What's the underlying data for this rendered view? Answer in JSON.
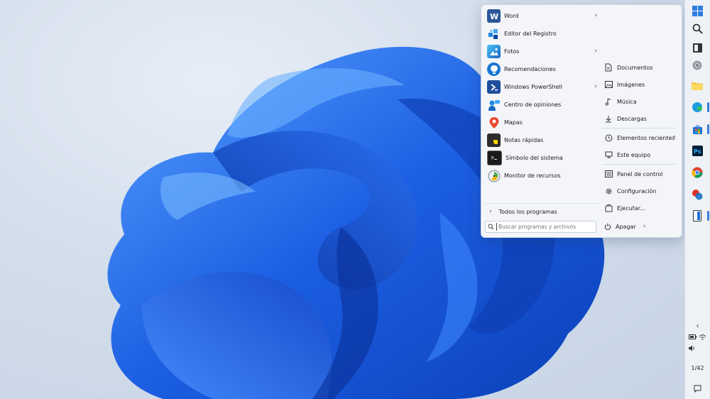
{
  "start_menu": {
    "programs": [
      {
        "label": "Word",
        "icon": "word-icon",
        "has_submenu": true
      },
      {
        "label": "Editor del Registro",
        "icon": "registry-editor-icon",
        "has_submenu": false
      },
      {
        "label": "Fotos",
        "icon": "photos-icon",
        "has_submenu": true
      },
      {
        "label": "Recomendaciones",
        "icon": "tips-icon",
        "has_submenu": false
      },
      {
        "label": "Windows PowerShell",
        "icon": "powershell-icon",
        "has_submenu": true
      },
      {
        "label": "Centro de opiniones",
        "icon": "feedback-hub-icon",
        "has_submenu": false
      },
      {
        "label": "Mapas",
        "icon": "maps-icon",
        "has_submenu": false
      },
      {
        "label": "Notas rápidas",
        "icon": "sticky-notes-icon",
        "has_submenu": false
      },
      {
        "label": "Símbolo del sistema",
        "icon": "command-prompt-icon",
        "has_submenu": false
      },
      {
        "label": "Monitor de recursos",
        "icon": "resource-monitor-icon",
        "has_submenu": false
      }
    ],
    "all_programs_label": "Todos los programas",
    "search": {
      "placeholder": "Buscar programas y archivos"
    },
    "places": {
      "documents": "Documentos",
      "pictures": "Imágenes",
      "music": "Música",
      "downloads": "Descargas",
      "recent": "Elementos recientes",
      "this_pc": "Este equipo",
      "control_panel": "Panel de control",
      "settings": "Configuración",
      "run": "Ejecutar..."
    },
    "shutdown_label": "Apagar"
  },
  "taskbar": {
    "clock": "1/42",
    "apps": [
      "start-icon",
      "search-icon",
      "task-view-icon",
      "chrome-icon",
      "file-explorer-icon",
      "edge-icon",
      "store-icon",
      "photoshop-icon",
      "chrome-icon",
      "office-icon",
      "notes-app-icon"
    ]
  },
  "colors": {
    "accent": "#3b7bd6",
    "wallpaper_blue": "#1f63e0"
  }
}
